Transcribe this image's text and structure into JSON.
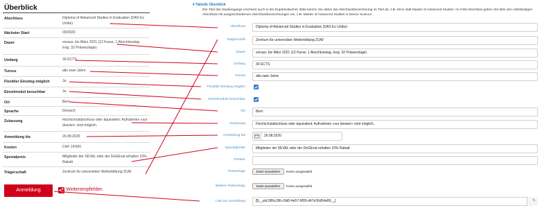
{
  "left": {
    "title": "Überblick",
    "rows": [
      {
        "key": "Abschluss",
        "value": "Diploma of Advanced Studies in Evaluation (DAS Ev Unibe)"
      },
      {
        "key": "Nächster Start",
        "value": "09/2020"
      },
      {
        "key": "Dauer",
        "value": "voraus. bis März 2021 (12 Kurse, 1 Abschlusstag, insg. 32 Präsenztage)"
      },
      {
        "key": "Umfang",
        "value": "30 ECTS"
      },
      {
        "key": "Turnus",
        "value": "alle zwei Jahre"
      },
      {
        "key": "Flexibler Einstieg möglich",
        "value": "Ja"
      },
      {
        "key": "Einzelmodul besuchbar",
        "value": "Ja"
      },
      {
        "key": "Ort",
        "value": "Bern"
      },
      {
        "key": "Sprache",
        "value": "Deutsch"
      },
      {
        "key": "Zulassung",
        "value": "Hochschulabschluss oder äquivalent; Aufnahmen «sur dossier» sind möglich."
      },
      {
        "key": "Anmeldung bis",
        "value": "26.08.2020"
      },
      {
        "key": "Kosten",
        "value": "CHF 14'000"
      },
      {
        "key": "Spezialpreis",
        "value": "Mitglieder der SEVAL oder der DeGEval erhalten 10% Rabatt"
      },
      {
        "key": "Trägerschaft",
        "value": "Zentrum für universitäre Weiterbildung ZUW"
      }
    ],
    "register_button": "Anmeldung",
    "share_label": "Weiterempfehlen",
    "share_icon": "share-icon",
    "accent_color": "#d0021b"
  },
  "right": {
    "section_title": "▾ Tabelle Überblick",
    "info_text": "Der Titel des Studiengangs erscheint auch in der Ergebniskachel. Bitte kürzen Sie daher die Abschlussbezeichnung im Titel ab, z.B. MAS statt Master of Advanced Studies. Im Feld Abschluss geben Sie bitte den vollständigen Abschluss mit ausgeschriebenen Abschlussbezeichnungen ein, z.B. Master of Advanced Studies in Dance Science.",
    "fields": {
      "abschluss": {
        "label": "Abschluss",
        "value": "Diploma of Advanced Studies in Evaluation (DAS Ev Unibe)"
      },
      "traegerschaft": {
        "label": "Trägerschaft",
        "value": "Zentrum für universitäre Weiterbildung ZUW"
      },
      "dauer": {
        "label": "Dauer",
        "value": "voraus. bis März 2021 (12 Kurse, 1 Abschlusstag, insg. 32 Präsenztage)"
      },
      "umfang": {
        "label": "Umfang",
        "value": "30 ECTS"
      },
      "turnus": {
        "label": "Turnus",
        "value": "alle zwei Jahre"
      },
      "flex": {
        "label": "Flexibler Einstieg möglich",
        "checked": true
      },
      "einzel": {
        "label": "Einzelmodule besuchbar",
        "checked": true
      },
      "ort": {
        "label": "Ort",
        "value": "Bern"
      },
      "zulassung": {
        "label": "Zulassung",
        "value": "Hochschulabschluss oder äquivalent; Aufnahmen «sur dossier» sind möglich."
      },
      "anmeldung_bis": {
        "label": "Anmeldung bis",
        "value": "26.08.2020"
      },
      "spezialpreise": {
        "label": "Spezialpreise",
        "value": "Mitglieder der SEVAL oder der DeGEval erhalten 10% Rabatt"
      },
      "partner": {
        "label": "Partner",
        "value": ""
      },
      "partnerlogo": {
        "label": "Partnerlogo"
      },
      "weitere_partnerlogo": {
        "label": "Weitere Partnerlogo"
      },
      "link_anmeldung": {
        "label": "Link zur Anmeldung",
        "value": "[$__uid:38fcc3f6-c5d0-4e57-9f05-d47e36d54e89__]"
      }
    },
    "file_button": "Datei auswählen",
    "file_none": "Keine ausgewählt",
    "checkbox_color": "#2f7cd6",
    "label_color": "#3c8dcf",
    "arrow_color": "#d0021b"
  }
}
